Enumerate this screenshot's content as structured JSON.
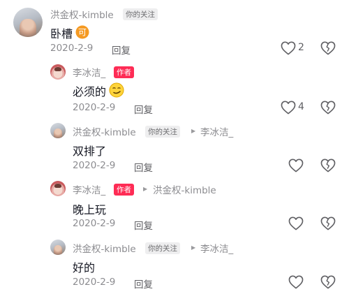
{
  "comments": [
    {
      "username": "洪金权-kimble",
      "tag": "你的关注",
      "content": "卧槽",
      "date": "2020-2-9",
      "reply_label": "回复",
      "like_count": "2"
    },
    {
      "username": "李冰洁_",
      "tag": "作者",
      "content": "必须的",
      "date": "2020-2-9",
      "reply_label": "回复",
      "like_count": "4"
    },
    {
      "username": "洪金权-kimble",
      "tag": "你的关注",
      "reply_to": "李冰洁_",
      "content": "双排了",
      "date": "2020-2-9",
      "reply_label": "回复"
    },
    {
      "username": "李冰洁_",
      "tag": "作者",
      "reply_to": "洪金权-kimble",
      "content": "晚上玩",
      "date": "2020-2-9",
      "reply_label": "回复"
    },
    {
      "username": "洪金权-kimble",
      "tag": "你的关注",
      "reply_to": "李冰洁_",
      "content": "好的",
      "date": "2020-2-9",
      "reply_label": "回复"
    }
  ],
  "emojis": [
    "可",
    "smirk-emoji"
  ],
  "colors": {
    "author_tag": "#fe2c55",
    "muted_text": "#8c8c90",
    "content_text": "#161823"
  }
}
